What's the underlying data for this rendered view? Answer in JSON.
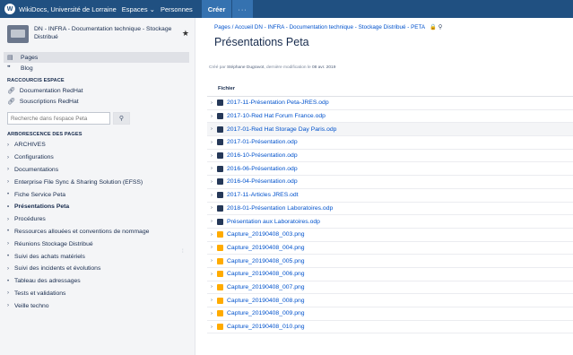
{
  "topbar": {
    "logo_label": "W",
    "nav": [
      "WikiDocs, Université de Lorraine",
      "Espaces ⌄",
      "Personnes"
    ],
    "create_label": "Créer",
    "more_label": "···"
  },
  "sidebar": {
    "space_name": "DN - INFRA - Documentation technique - Stockage Distribué",
    "links": [
      {
        "icon": "▤",
        "label": "Pages"
      },
      {
        "icon": "❞",
        "label": "Blog"
      }
    ],
    "shortcuts_title": "RACCOURCIS ESPACE",
    "shortcuts": [
      "Documentation RedHat",
      "Souscriptions RedHat"
    ],
    "search_placeholder": "Recherche dans l'espace Peta",
    "tree_title": "ARBORESCENCE DES PAGES",
    "tree": [
      {
        "chev": "›",
        "label": "ARCHIVES"
      },
      {
        "chev": "›",
        "label": "Configurations"
      },
      {
        "chev": "›",
        "label": "Documentations"
      },
      {
        "chev": "›",
        "label": "Enterprise File Sync & Sharing Solution (EFSS)"
      },
      {
        "chev": "•",
        "label": "Fiche Service Peta"
      },
      {
        "chev": "•",
        "label": "Présentations Peta"
      },
      {
        "chev": "›",
        "label": "Procédures"
      },
      {
        "chev": "•",
        "label": "Ressources allouées et conventions de nommage"
      },
      {
        "chev": "›",
        "label": "Réunions Stockage Distribué"
      },
      {
        "chev": "•",
        "label": "Suivi des achats matériels"
      },
      {
        "chev": "›",
        "label": "Suivi des incidents et évolutions"
      },
      {
        "chev": "•",
        "label": "Tableau des adressages"
      },
      {
        "chev": "›",
        "label": "Tests et validations"
      },
      {
        "chev": "›",
        "label": "Veille techno"
      }
    ]
  },
  "main": {
    "breadcrumb": "Pages  /  Accueil DN - INFRA - Documentation technique - Stockage Distribué - PETA",
    "tools": "🔒 ⚲",
    "title": "Présentations Peta",
    "byline_prefix": "Créé par",
    "byline_author": "Stéphane Dugravot",
    "byline_mid": ", dernière modification le",
    "byline_date": "08 avr. 2019",
    "column_header": "Fichier",
    "files": [
      {
        "name": "2017-11-Présentation Peta-JRES.odp",
        "type": "doc"
      },
      {
        "name": "2017-10-Red Hat Forum France.odp",
        "type": "doc"
      },
      {
        "name": "2017-01-Red Hat Storage Day Paris.odp",
        "type": "doc"
      },
      {
        "name": "2017-01-Présentation.odp",
        "type": "doc"
      },
      {
        "name": "2016-10-Présentation.odp",
        "type": "doc"
      },
      {
        "name": "2016-06-Présentation.odp",
        "type": "doc"
      },
      {
        "name": "2016-04-Présentation.odp",
        "type": "doc"
      },
      {
        "name": "2017-11-Articles JRES.odt",
        "type": "doc"
      },
      {
        "name": "2018-01-Présentation Laboratoires.odp",
        "type": "doc"
      },
      {
        "name": "Présentation aux Laboratoires.odp",
        "type": "doc"
      },
      {
        "name": "Capture_20190408_003.png",
        "type": "img"
      },
      {
        "name": "Capture_20190408_004.png",
        "type": "img"
      },
      {
        "name": "Capture_20190408_005.png",
        "type": "img"
      },
      {
        "name": "Capture_20190408_006.png",
        "type": "img"
      },
      {
        "name": "Capture_20190408_007.png",
        "type": "img"
      },
      {
        "name": "Capture_20190408_008.png",
        "type": "img"
      },
      {
        "name": "Capture_20190408_009.png",
        "type": "img"
      },
      {
        "name": "Capture_20190408_010.png",
        "type": "img"
      }
    ],
    "highlight_row": 2
  }
}
